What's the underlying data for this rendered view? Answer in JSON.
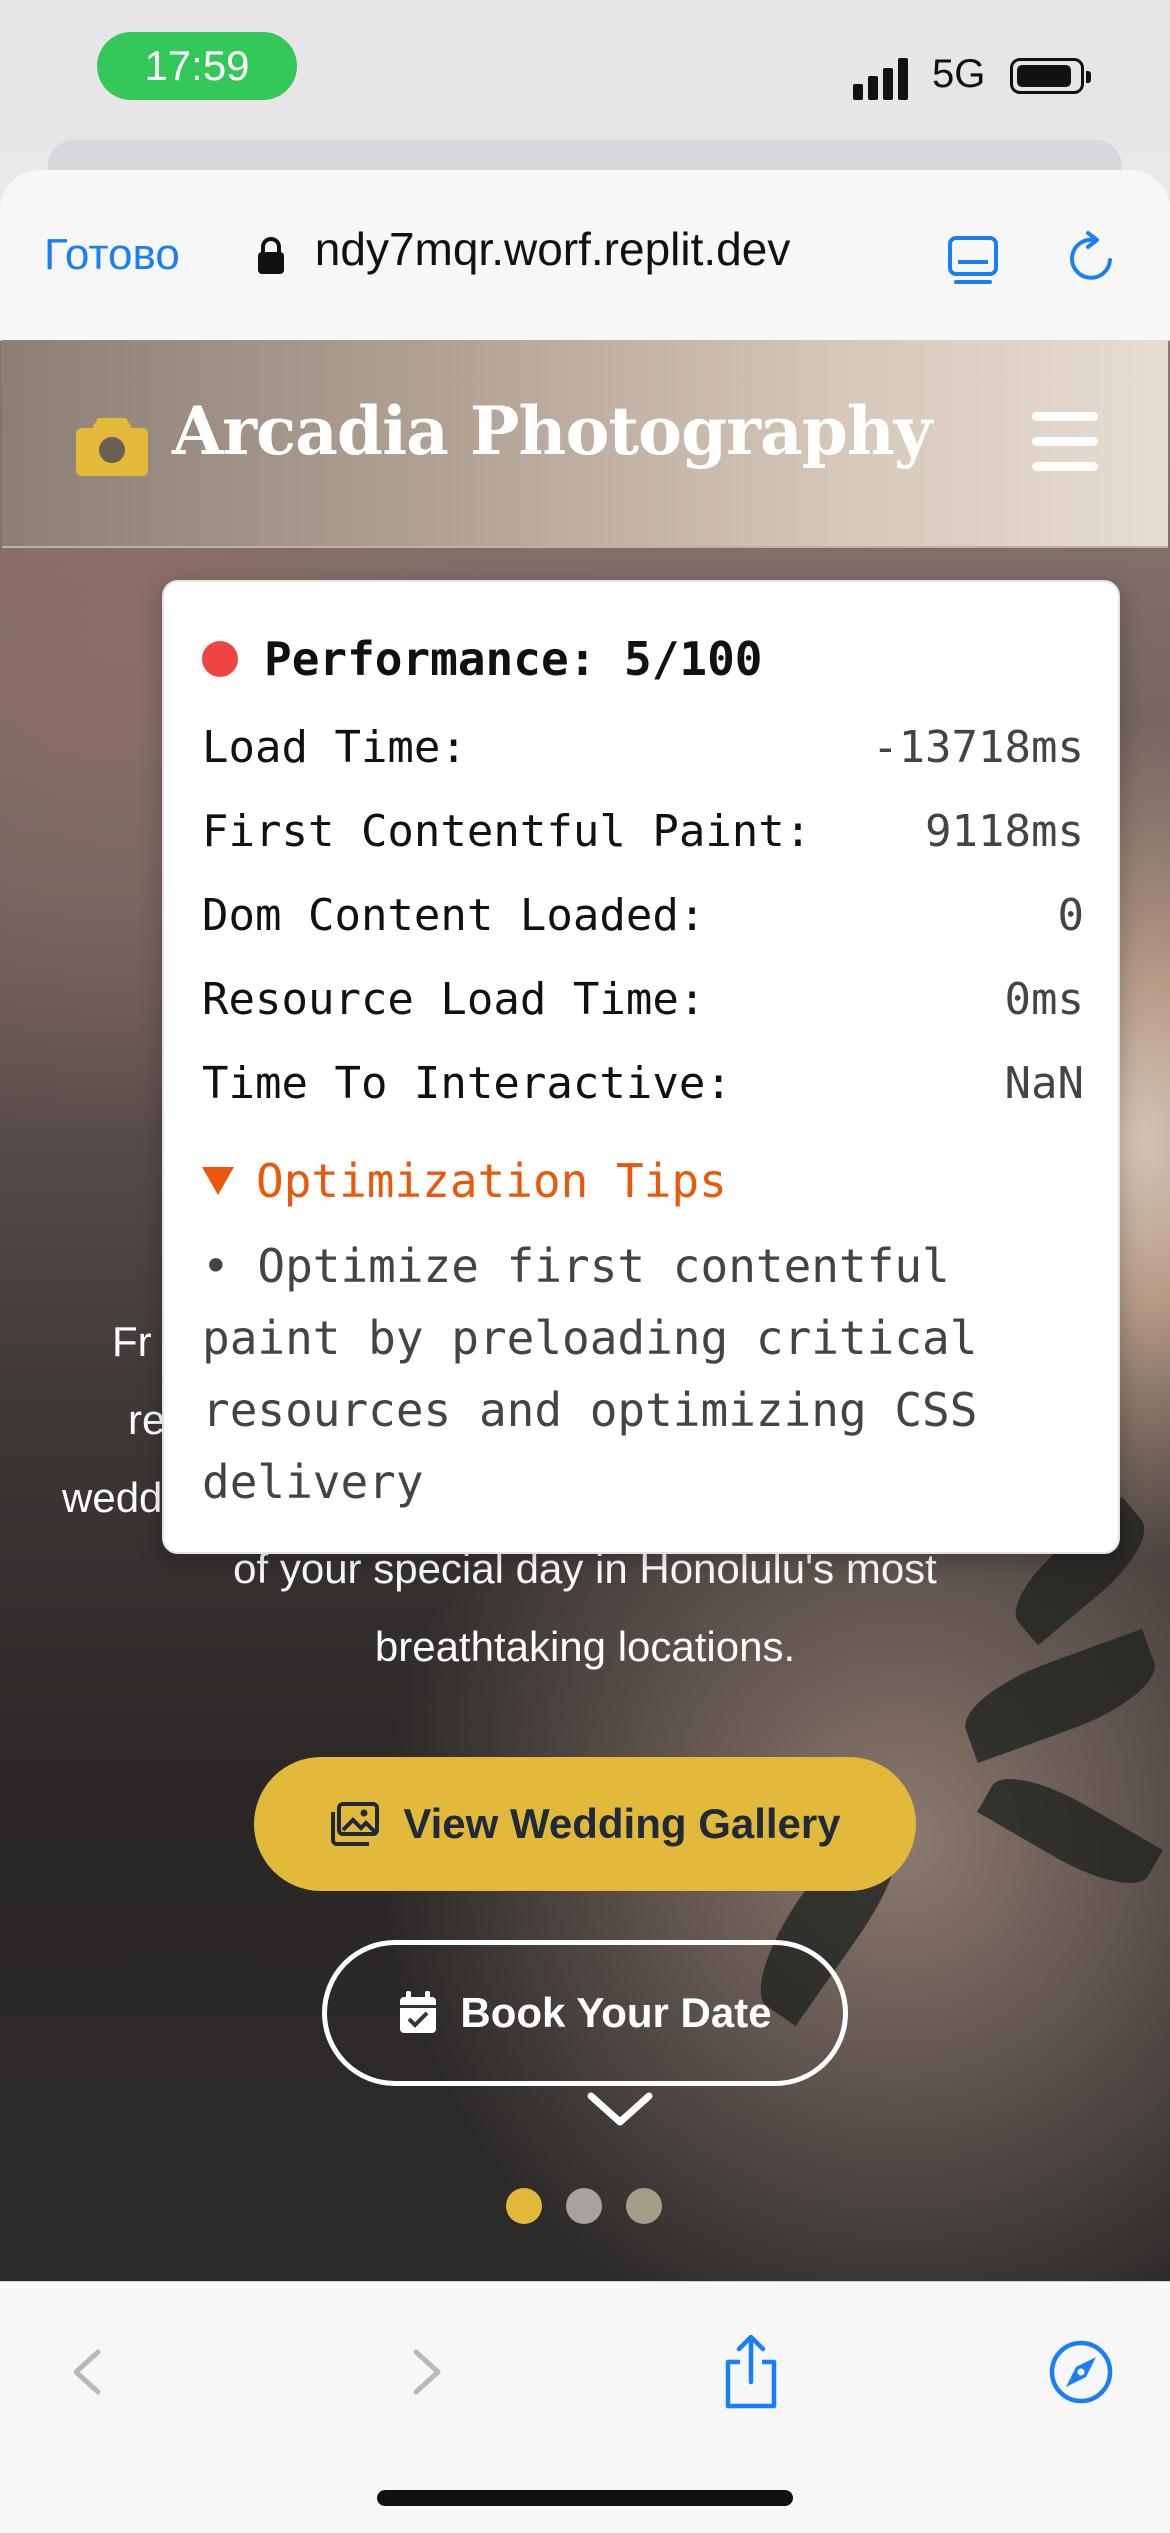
{
  "status_bar": {
    "time": "17:59",
    "network": "5G"
  },
  "browser": {
    "done_label": "Готово",
    "url": " ndy7mqr.worf.replit.dev",
    "icons": {
      "lock": "lock-icon",
      "reader": "reader-icon",
      "reload": "reload-icon"
    }
  },
  "site": {
    "brand": "Arcadia Photography",
    "hero_lines": [
      "Fr",
      "re",
      "wedd",
      "of your special day in Honolulu's most",
      "breathtaking locations."
    ],
    "cta_primary": "View Wedding Gallery",
    "cta_secondary": "Book Your Date",
    "carousel_dots": 3,
    "accent": "#e2b93b"
  },
  "performance": {
    "title": "Performance: 5/100",
    "metrics": [
      {
        "label": "Load Time:",
        "value": "-13718ms"
      },
      {
        "label": "First Contentful Paint:",
        "value": "9118ms"
      },
      {
        "label": "Dom Content Loaded:",
        "value": "0"
      },
      {
        "label": "Resource Load Time:",
        "value": "0ms"
      },
      {
        "label": "Time To Interactive:",
        "value": "NaN"
      }
    ],
    "tips_heading": "Optimization Tips",
    "tip": "• Optimize first contentful paint by preloading critical resources and optimizing CSS delivery"
  },
  "bottom_bar": {
    "icons": [
      "back-icon",
      "forward-icon",
      "share-icon",
      "compass-icon"
    ]
  }
}
